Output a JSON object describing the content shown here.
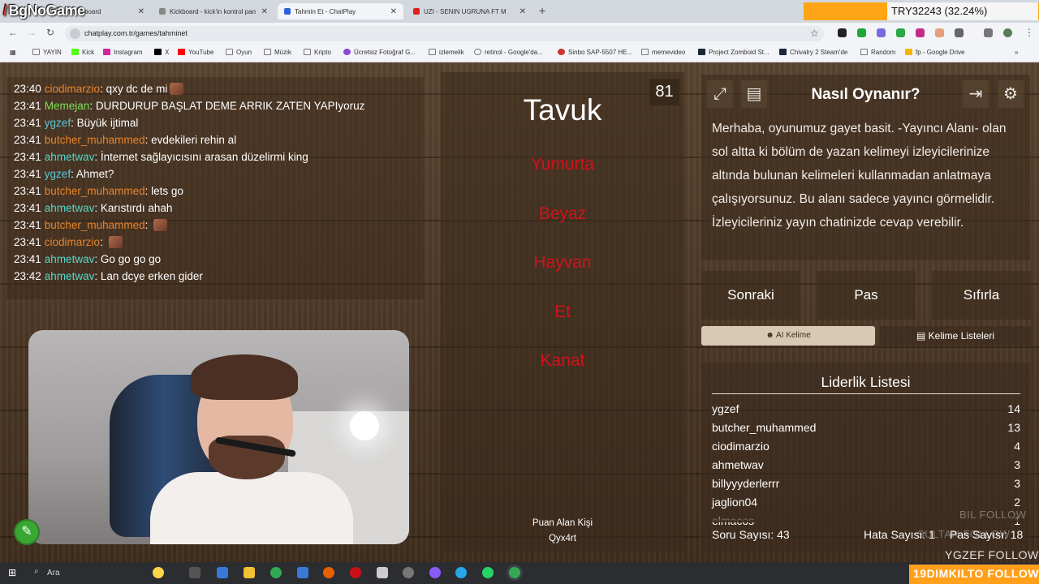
{
  "stream_overlay": {
    "channel_brand": "BgNoGame",
    "currency_label": "TRY32243 (32.24%)",
    "follow_badge": "19DIMKILTO FOLLOW",
    "follow_line_2": "YGZEF FOLLOW",
    "follow_line_3": "SULTAN FOLLOW",
    "follow_ghost": "BIL FOLLOW"
  },
  "browser": {
    "tabs": [
      {
        "label": "board",
        "active": false
      },
      {
        "label": "Kickboard - kick'in kontrol pan",
        "active": false
      },
      {
        "label": "Tahmin Et - ChatPlay",
        "active": true
      },
      {
        "label": "UZI - SENIN UGRUNA FT M",
        "active": false
      }
    ],
    "url": "chatplay.com.tr/games/tahminet",
    "bookmarks": [
      "YAYIN",
      "Kick",
      "Instagram",
      "X",
      "YouTube",
      "Oyun",
      "Müzik",
      "Kripto",
      "Ücretsiz Fotoğraf G...",
      "izlemelik",
      "retinol - Google'da...",
      "Sinbo SAP-5507 HE...",
      "memevideo",
      "Project Zomboid St...",
      "Chivalry 2 Steam'de",
      "Random",
      "fp - Google Drive"
    ]
  },
  "chat": {
    "messages": [
      {
        "time": "23:40",
        "user": "ciodimarzio",
        "color": "#e8842a",
        "text": "qxy dc de mi",
        "emote": true
      },
      {
        "time": "23:41",
        "user": "Memejan",
        "color": "#7fe05a",
        "text": "DURDURUP BAŞLAT DEME ARRIK ZATEN YAPIyoruz",
        "emote": false
      },
      {
        "time": "23:41",
        "user": "ygzef",
        "color": "#56c7d9",
        "text": "Büyük ijtimal",
        "emote": false
      },
      {
        "time": "23:41",
        "user": "butcher_muhammed",
        "color": "#e8842a",
        "text": "evdekileri rehin al",
        "emote": false
      },
      {
        "time": "23:41",
        "user": "ahmetwav",
        "color": "#56d9c7",
        "text": "İnternet sağlayıcısını arasan düzelirmi king",
        "emote": false
      },
      {
        "time": "23:41",
        "user": "ygzef",
        "color": "#56c7d9",
        "text": "Ahmet?",
        "emote": false
      },
      {
        "time": "23:41",
        "user": "butcher_muhammed",
        "color": "#e8842a",
        "text": "lets go",
        "emote": false
      },
      {
        "time": "23:41",
        "user": "ahmetwav",
        "color": "#56d9c7",
        "text": "Karıstırdı ahah",
        "emote": false
      },
      {
        "time": "23:41",
        "user": "butcher_muhammed",
        "color": "#e8842a",
        "text": "",
        "emote": true
      },
      {
        "time": "23:41",
        "user": "ciodimarzio",
        "color": "#e8842a",
        "text": "",
        "emote": true
      },
      {
        "time": "23:41",
        "user": "ahmetwav",
        "color": "#56d9c7",
        "text": "Go go go go",
        "emote": false
      },
      {
        "time": "23:42",
        "user": "ahmetwav",
        "color": "#56d9c7",
        "text": "Lan dcye erken gider",
        "emote": false
      }
    ]
  },
  "game": {
    "counter": "81",
    "word": "Tavuk",
    "forbidden": [
      "Yumurta",
      "Beyaz",
      "Hayvan",
      "Et",
      "Kanat"
    ],
    "scorer_label": "Puan Alan Kişi",
    "scorer_name": "Qyx4rt"
  },
  "howto": {
    "title": "Nasıl Oynanır?",
    "text": "Merhaba, oyunumuz gayet basit. -Yayıncı Alanı- olan sol altta ki bölüm de yazan kelimeyi izleyicilerinize altında bulunan kelimeleri kullanmadan anlatmaya çalışıyorsunuz. Bu alanı sadece yayıncı görmelidir. İzleyicileriniz yayın chatinizde cevap verebilir."
  },
  "controls": {
    "next": "Sonraki",
    "pass": "Pas",
    "reset": "Sıfırla",
    "ai_word": "AI Kelime",
    "word_lists": "Kelime Listeleri"
  },
  "leaderboard": {
    "title": "Liderlik Listesi",
    "rows": [
      {
        "name": "ygzef",
        "score": "14"
      },
      {
        "name": "butcher_muhammed",
        "score": "13"
      },
      {
        "name": "ciodimarzio",
        "score": "4"
      },
      {
        "name": "ahmetwav",
        "score": "3"
      },
      {
        "name": "billyyyderlerrr",
        "score": "3"
      },
      {
        "name": "jaglion04",
        "score": "2"
      },
      {
        "name": "elmacos",
        "score": "1"
      }
    ],
    "question_count": "Soru Sayısı: 43",
    "error_count": "Hata Sayısı: 1",
    "pass_count": "Pas Sayısı: 18"
  },
  "taskbar": {
    "search": "Ara"
  },
  "colors": {
    "accent_orange": "#ffa516",
    "forbidden_red": "#d1131b"
  }
}
